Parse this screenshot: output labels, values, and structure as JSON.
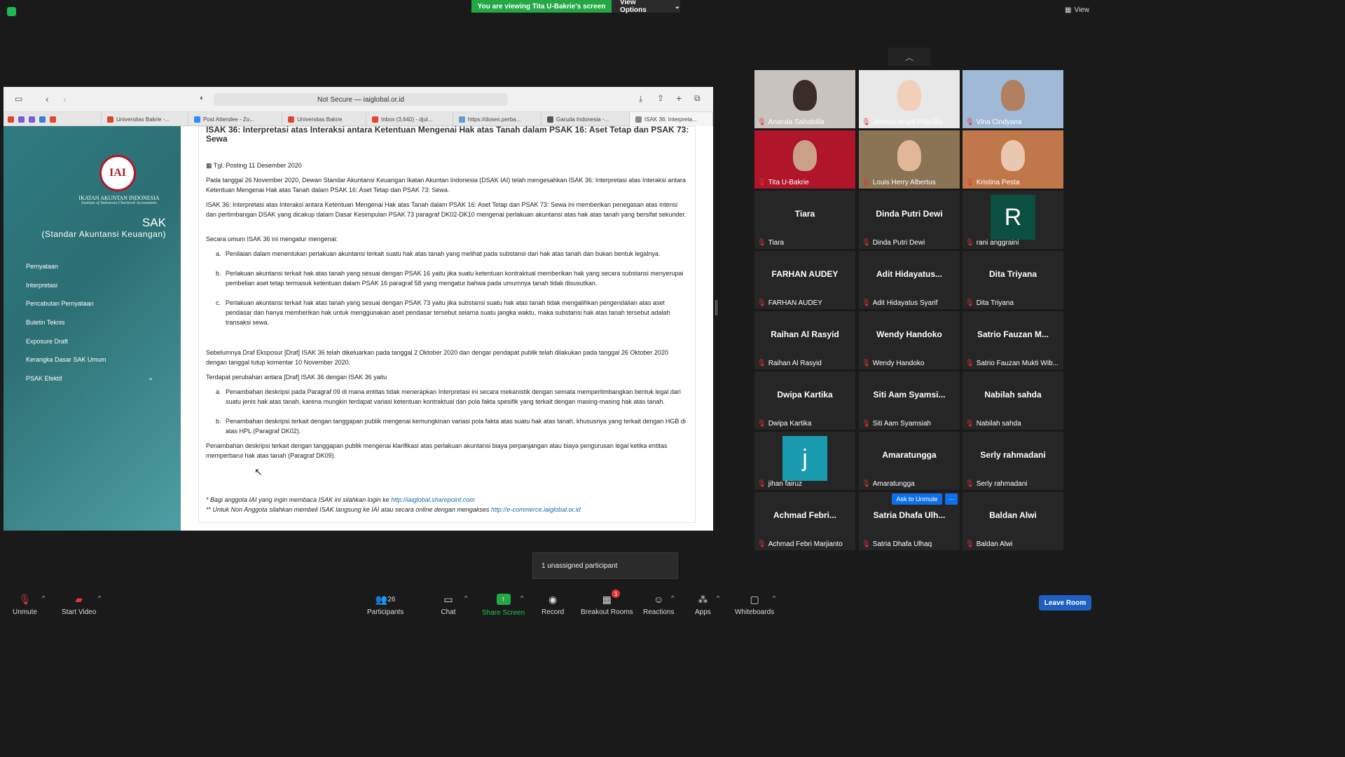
{
  "banner": {
    "viewing": "You are viewing Tita U-Bakrie's screen",
    "view_options": "View Options",
    "view": "View"
  },
  "browser": {
    "address": "Not Secure — iaiglobal.or.id",
    "tabs": [
      {
        "label": "Universitas Bakrie -...",
        "color": "#d9482b"
      },
      {
        "label": "Post Attendee - Zo...",
        "color": "#2d8cff"
      },
      {
        "label": "Universitas Bakrie",
        "color": "#d9482b"
      },
      {
        "label": "Inbox (3,640) - djul...",
        "color": "#ea4335"
      },
      {
        "label": "https://dosen.perba...",
        "color": "#6a9bd1"
      },
      {
        "label": "Garuda Indonesia -...",
        "color": "#555555"
      },
      {
        "label": "ISAK 36: Interpreta...",
        "color": "#8a8a8a"
      }
    ]
  },
  "site": {
    "logo_text": "IAI",
    "org_name": "IKATAN AKUNTAN INDONESIA",
    "org_sub": "Institute of Indonesia Chartered Accountants",
    "sak": "SAK",
    "sak_sub": "(Standar Akuntansi Keuangan)",
    "nav": [
      "Pernyataan",
      "Interpretasi",
      "Pencabutan Pernyataan",
      "Buletin Teknis",
      "Exposure Draft",
      "Kerangka Dasar SAK Umum",
      "PSAK Efektif"
    ]
  },
  "doc": {
    "title": "ISAK 36: Interpretasi atas Interaksi antara Ketentuan Mengenai Hak atas Tanah dalam PSAK 16: Aset Tetap dan PSAK 73: Sewa",
    "date": "Tgl. Posting 11 Desember 2020",
    "p1": "Pada tanggal 26 November 2020, Dewan Standar Akuntansi Keuangan Ikatan Akuntan Indonesia (DSAK IAI) telah mengesahkan ISAK 36: Interpretasi atas Interaksi antara Ketentuan Mengenai Hak atas Tanah dalam PSAK 16: Aset Tetap dan PSAK 73: Sewa.",
    "p2": "ISAK 36: Interpretasi atas Interaksi antara Ketentuan Mengenai Hak atas Tanah dalam PSAK 16: Aset Tetap dan PSAK 73: Sewa ini memberikan penegasan atas intensi dan pertimbangan DSAK yang dicakup dalam Dasar Kesimpulan PSAK 73 paragraf DK02-DK10 mengenai perlakuan akuntansi atas hak atas tanah yang bersifat sekunder.",
    "p3": "Secara umum ISAK 36 ini mengatur mengenai:",
    "l1a": "Penilaian dalam menentukan perlakuan akuntansi terkait suatu hak atas tanah yang melihat pada substansi dari hak atas tanah dan bukan bentuk legalnya.",
    "l1b": "Perlakuan akuntansi terkait hak atas tanah yang sesuai dengan PSAK 16 yaitu jika suatu ketentuan kontraktual memberikan hak yang secara substansi menyerupai pembelian aset tetap termasuk ketentuan dalam PSAK 16 paragraf 58 yang mengatur bahwa pada umumnya tanah tidak disusutkan.",
    "l1c": "Perlakuan akuntansi terkait hak atas tanah yang sesuai dengan PSAK 73 yaitu jika substansi suatu hak atas tanah tidak mengalihkan pengendalian atas aset pendasar dan hanya memberikan hak untuk menggunakan aset pendasar tersebut selama suatu jangka waktu, maka substansi hak atas tanah tersebut adalah transaksi sewa.",
    "p4": "Sebelumnya Draf Eksposur [Draf] ISAK 36 telah dikeluarkan pada tanggal 2 Oktober 2020 dan dengar pendapat publik telah dilakukan pada tanggal 26 Oktober 2020 dengan tanggal tutup komentar 10 November 2020.",
    "p5": "Terdapat perubahan antara [Draf] ISAK 36 dengan ISAK 36 yaitu",
    "l2a": "Penambahan deskripsi pada Paragraf 09 di mana entitas tidak menerapkan Interpretasi ini secara mekanistik dengan semata mempertimbangkan bentuk legal dari suatu jenis hak atas tanah, karena mungkin terdapat variasi ketentuan kontraktual dan pola fakta spesifik yang terkait dengan masing-masing hak atas tanah.",
    "l2b": "Penambahan deskripsi terkait dengan tanggapan publik mengenai kemungkinan variasi pola fakta atas suatu hak atas tanah, khususnya yang terkait dengan HGB di atas HPL (Paragraf DK02).",
    "p6": "Penambahan deskripsi terkait dengan tanggapan publik mengenai klarifikasi atas perlakuan akuntansi biaya perpanjangan atau biaya pengurusan legal ketika entitas memperbarui hak atas tanah (Paragraf DK09).",
    "note1": "* Bagi anggota IAI yang ingin membaca ISAK ini silahkan login ke ",
    "note1_link": "http://iaiglobal.sharepoint.com",
    "note2": "** Untuk Non Anggota silahkan membeli ISAK langsung ke IAI atau secara online dengan mengakses ",
    "note2_link": "http://e-commerce.iaiglobal.or.id"
  },
  "participants": [
    {
      "label": "Ananda Salsabilla",
      "big": "",
      "bg": "#c9c3bf",
      "skin": "#3a2c28"
    },
    {
      "label": "Jessica Angel Priscillia",
      "big": "",
      "bg": "#e8e8e8",
      "skin": "#f0d0b8"
    },
    {
      "label": "Vina Cindyana",
      "big": "",
      "bg": "#9fb9d6",
      "skin": "#b08060"
    },
    {
      "label": "Tita U-Bakrie",
      "big": "",
      "bg": "#b0152a",
      "skin": "#caa088"
    },
    {
      "label": "Louis Herry Albertus",
      "big": "",
      "bg": "#8b7355",
      "skin": "#e0b898"
    },
    {
      "label": "Kristina Pesta",
      "big": "",
      "bg": "#c0784a",
      "skin": "#e8c8b0"
    },
    {
      "label": "Tiara",
      "big": "Tiara"
    },
    {
      "label": "Dinda Putri Dewi",
      "big": "Dinda Putri Dewi"
    },
    {
      "label": "rani anggraini",
      "big": "",
      "letter": "R",
      "letter_bg": "#0b4f40"
    },
    {
      "label": "FARHAN AUDEY",
      "big": "FARHAN AUDEY"
    },
    {
      "label": "Adit Hidayatus Syarif",
      "big": "Adit  Hidayatus..."
    },
    {
      "label": "Dita Triyana",
      "big": "Dita Triyana"
    },
    {
      "label": "Raihan Al Rasyid",
      "big": "Raihan Al Rasyid"
    },
    {
      "label": "Wendy Handoko",
      "big": "Wendy Handoko"
    },
    {
      "label": "Satrio Fauzan Mukti Wib...",
      "big": "Satrio  Fauzan M..."
    },
    {
      "label": "Dwipa Kartika",
      "big": "Dwipa Kartika"
    },
    {
      "label": "Siti Aam Syamsiah",
      "big": "Siti  Aam  Syamsi..."
    },
    {
      "label": "Nabilah sahda",
      "big": "Nabilah sahda"
    },
    {
      "label": "jihan fairuz",
      "big": "",
      "letter": "j",
      "letter_bg": "#1a9bb0"
    },
    {
      "label": "Amaratungga",
      "big": "Amaratungga"
    },
    {
      "label": "Serly rahmadani",
      "big": "Serly rahmadani"
    },
    {
      "label": "Achmad Febri Marjianto",
      "big": "Achmad  Febri..."
    },
    {
      "label": "Satria Dhafa Ulhaq",
      "big": "Satria  Dhafa  Ulh..."
    },
    {
      "label": "Baldan Alwi",
      "big": "Baldan Alwi"
    }
  ],
  "ask_unmute": "Ask to Unmute",
  "ask_more": "···",
  "unassigned": "1 unassigned participant",
  "controls": {
    "unmute": "Unmute",
    "start_video": "Start Video",
    "participants": "Participants",
    "participants_count": "26",
    "chat": "Chat",
    "share_screen": "Share Screen",
    "record": "Record",
    "breakout": "Breakout Rooms",
    "breakout_badge": "1",
    "reactions": "Reactions",
    "apps": "Apps",
    "whiteboards": "Whiteboards",
    "leave": "Leave Room"
  }
}
